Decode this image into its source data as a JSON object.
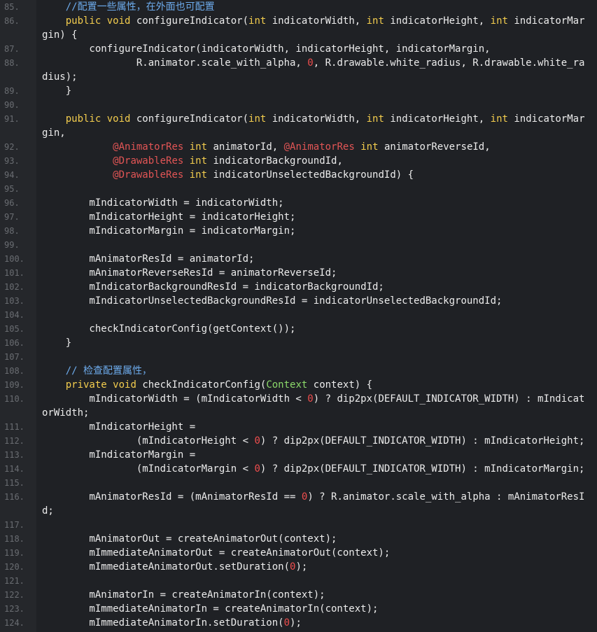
{
  "editor": {
    "rows": [
      {
        "ln": "85.",
        "segs": [
          {
            "t": "    ",
            "k": "p"
          },
          {
            "t": "//配置一些属性，在外面也可配置",
            "k": "c"
          }
        ]
      },
      {
        "ln": "86.",
        "segs": [
          {
            "t": "    ",
            "k": "p"
          },
          {
            "t": "public",
            "k": "k"
          },
          {
            "t": " ",
            "k": "p"
          },
          {
            "t": "void",
            "k": "k"
          },
          {
            "t": " configureIndicator(",
            "k": "p"
          },
          {
            "t": "int",
            "k": "k"
          },
          {
            "t": " indicatorWidth, ",
            "k": "p"
          },
          {
            "t": "int",
            "k": "k"
          },
          {
            "t": " indicatorHeight, ",
            "k": "p"
          },
          {
            "t": "int",
            "k": "k"
          },
          {
            "t": " indicatorMar",
            "k": "p"
          }
        ]
      },
      {
        "ln": "",
        "segs": [
          {
            "t": "gin) {",
            "k": "p"
          }
        ]
      },
      {
        "ln": "87.",
        "segs": [
          {
            "t": "        configureIndicator(indicatorWidth, indicatorHeight, indicatorMargin,",
            "k": "p"
          }
        ]
      },
      {
        "ln": "88.",
        "segs": [
          {
            "t": "                R.animator.scale_with_alpha, ",
            "k": "p"
          },
          {
            "t": "0",
            "k": "n"
          },
          {
            "t": ", R.drawable.white_radius, R.drawable.white_ra",
            "k": "p"
          }
        ]
      },
      {
        "ln": "",
        "segs": [
          {
            "t": "dius);",
            "k": "p"
          }
        ]
      },
      {
        "ln": "89.",
        "segs": [
          {
            "t": "    }",
            "k": "p"
          }
        ]
      },
      {
        "ln": "90.",
        "segs": []
      },
      {
        "ln": "91.",
        "segs": [
          {
            "t": "    ",
            "k": "p"
          },
          {
            "t": "public",
            "k": "k"
          },
          {
            "t": " ",
            "k": "p"
          },
          {
            "t": "void",
            "k": "k"
          },
          {
            "t": " configureIndicator(",
            "k": "p"
          },
          {
            "t": "int",
            "k": "k"
          },
          {
            "t": " indicatorWidth, ",
            "k": "p"
          },
          {
            "t": "int",
            "k": "k"
          },
          {
            "t": " indicatorHeight, ",
            "k": "p"
          },
          {
            "t": "int",
            "k": "k"
          },
          {
            "t": " indicatorMar",
            "k": "p"
          }
        ]
      },
      {
        "ln": "",
        "segs": [
          {
            "t": "gin,",
            "k": "p"
          }
        ]
      },
      {
        "ln": "92.",
        "segs": [
          {
            "t": "            ",
            "k": "p"
          },
          {
            "t": "@AnimatorRes",
            "k": "a"
          },
          {
            "t": " ",
            "k": "p"
          },
          {
            "t": "int",
            "k": "k"
          },
          {
            "t": " animatorId, ",
            "k": "p"
          },
          {
            "t": "@AnimatorRes",
            "k": "a"
          },
          {
            "t": " ",
            "k": "p"
          },
          {
            "t": "int",
            "k": "k"
          },
          {
            "t": " animatorReverseId,",
            "k": "p"
          }
        ]
      },
      {
        "ln": "93.",
        "segs": [
          {
            "t": "            ",
            "k": "p"
          },
          {
            "t": "@DrawableRes",
            "k": "a"
          },
          {
            "t": " ",
            "k": "p"
          },
          {
            "t": "int",
            "k": "k"
          },
          {
            "t": " indicatorBackgroundId,",
            "k": "p"
          }
        ]
      },
      {
        "ln": "94.",
        "segs": [
          {
            "t": "            ",
            "k": "p"
          },
          {
            "t": "@DrawableRes",
            "k": "a"
          },
          {
            "t": " ",
            "k": "p"
          },
          {
            "t": "int",
            "k": "k"
          },
          {
            "t": " indicatorUnselectedBackgroundId) {",
            "k": "p"
          }
        ]
      },
      {
        "ln": "95.",
        "segs": []
      },
      {
        "ln": "96.",
        "segs": [
          {
            "t": "        mIndicatorWidth = indicatorWidth;",
            "k": "p"
          }
        ]
      },
      {
        "ln": "97.",
        "segs": [
          {
            "t": "        mIndicatorHeight = indicatorHeight;",
            "k": "p"
          }
        ]
      },
      {
        "ln": "98.",
        "segs": [
          {
            "t": "        mIndicatorMargin = indicatorMargin;",
            "k": "p"
          }
        ]
      },
      {
        "ln": "99.",
        "segs": []
      },
      {
        "ln": "100.",
        "segs": [
          {
            "t": "        mAnimatorResId = animatorId;",
            "k": "p"
          }
        ]
      },
      {
        "ln": "101.",
        "segs": [
          {
            "t": "        mAnimatorReverseResId = animatorReverseId;",
            "k": "p"
          }
        ]
      },
      {
        "ln": "102.",
        "segs": [
          {
            "t": "        mIndicatorBackgroundResId = indicatorBackgroundId;",
            "k": "p"
          }
        ]
      },
      {
        "ln": "103.",
        "segs": [
          {
            "t": "        mIndicatorUnselectedBackgroundResId = indicatorUnselectedBackgroundId;",
            "k": "p"
          }
        ]
      },
      {
        "ln": "104.",
        "segs": []
      },
      {
        "ln": "105.",
        "segs": [
          {
            "t": "        checkIndicatorConfig(getContext());",
            "k": "p"
          }
        ]
      },
      {
        "ln": "106.",
        "segs": [
          {
            "t": "    }",
            "k": "p"
          }
        ]
      },
      {
        "ln": "107.",
        "segs": []
      },
      {
        "ln": "108.",
        "segs": [
          {
            "t": "    ",
            "k": "p"
          },
          {
            "t": "// 检查配置属性，",
            "k": "c"
          }
        ]
      },
      {
        "ln": "109.",
        "segs": [
          {
            "t": "    ",
            "k": "p"
          },
          {
            "t": "private",
            "k": "k"
          },
          {
            "t": " ",
            "k": "p"
          },
          {
            "t": "void",
            "k": "k"
          },
          {
            "t": " checkIndicatorConfig(",
            "k": "p"
          },
          {
            "t": "Context",
            "k": "t"
          },
          {
            "t": " context) {",
            "k": "p"
          }
        ]
      },
      {
        "ln": "110.",
        "segs": [
          {
            "t": "        mIndicatorWidth = (mIndicatorWidth < ",
            "k": "p"
          },
          {
            "t": "0",
            "k": "n"
          },
          {
            "t": ") ? dip2px(DEFAULT_INDICATOR_WIDTH) : mIndicat",
            "k": "p"
          }
        ]
      },
      {
        "ln": "",
        "segs": [
          {
            "t": "orWidth;",
            "k": "p"
          }
        ]
      },
      {
        "ln": "111.",
        "segs": [
          {
            "t": "        mIndicatorHeight =",
            "k": "p"
          }
        ]
      },
      {
        "ln": "112.",
        "segs": [
          {
            "t": "                (mIndicatorHeight < ",
            "k": "p"
          },
          {
            "t": "0",
            "k": "n"
          },
          {
            "t": ") ? dip2px(DEFAULT_INDICATOR_WIDTH) : mIndicatorHeight;",
            "k": "p"
          }
        ]
      },
      {
        "ln": "113.",
        "segs": [
          {
            "t": "        mIndicatorMargin =",
            "k": "p"
          }
        ]
      },
      {
        "ln": "114.",
        "segs": [
          {
            "t": "                (mIndicatorMargin < ",
            "k": "p"
          },
          {
            "t": "0",
            "k": "n"
          },
          {
            "t": ") ? dip2px(DEFAULT_INDICATOR_WIDTH) : mIndicatorMargin;",
            "k": "p"
          }
        ]
      },
      {
        "ln": "115.",
        "segs": []
      },
      {
        "ln": "116.",
        "segs": [
          {
            "t": "        mAnimatorResId = (mAnimatorResId == ",
            "k": "p"
          },
          {
            "t": "0",
            "k": "n"
          },
          {
            "t": ") ? R.animator.scale_with_alpha : mAnimatorResI",
            "k": "p"
          }
        ]
      },
      {
        "ln": "",
        "segs": [
          {
            "t": "d;",
            "k": "p"
          }
        ]
      },
      {
        "ln": "117.",
        "segs": []
      },
      {
        "ln": "118.",
        "segs": [
          {
            "t": "        mAnimatorOut = createAnimatorOut(context);",
            "k": "p"
          }
        ]
      },
      {
        "ln": "119.",
        "segs": [
          {
            "t": "        mImmediateAnimatorOut = createAnimatorOut(context);",
            "k": "p"
          }
        ]
      },
      {
        "ln": "120.",
        "segs": [
          {
            "t": "        mImmediateAnimatorOut.setDuration(",
            "k": "p"
          },
          {
            "t": "0",
            "k": "n"
          },
          {
            "t": ");",
            "k": "p"
          }
        ]
      },
      {
        "ln": "121.",
        "segs": []
      },
      {
        "ln": "122.",
        "segs": [
          {
            "t": "        mAnimatorIn = createAnimatorIn(context);",
            "k": "p"
          }
        ]
      },
      {
        "ln": "123.",
        "segs": [
          {
            "t": "        mImmediateAnimatorIn = createAnimatorIn(context);",
            "k": "p"
          }
        ]
      },
      {
        "ln": "124.",
        "segs": [
          {
            "t": "        mImmediateAnimatorIn.setDuration(",
            "k": "p"
          },
          {
            "t": "0",
            "k": "n"
          },
          {
            "t": ");",
            "k": "p"
          }
        ]
      }
    ]
  },
  "colors": {
    "background": "#1f2125",
    "gutter": "#25272b",
    "line_number": "#6a6d72",
    "plain": "#ececec",
    "keyword": "#f3cd4e",
    "number": "#ee4d4d",
    "annotation": "#e25555",
    "comment": "#6dabec",
    "type": "#8bd96a"
  }
}
